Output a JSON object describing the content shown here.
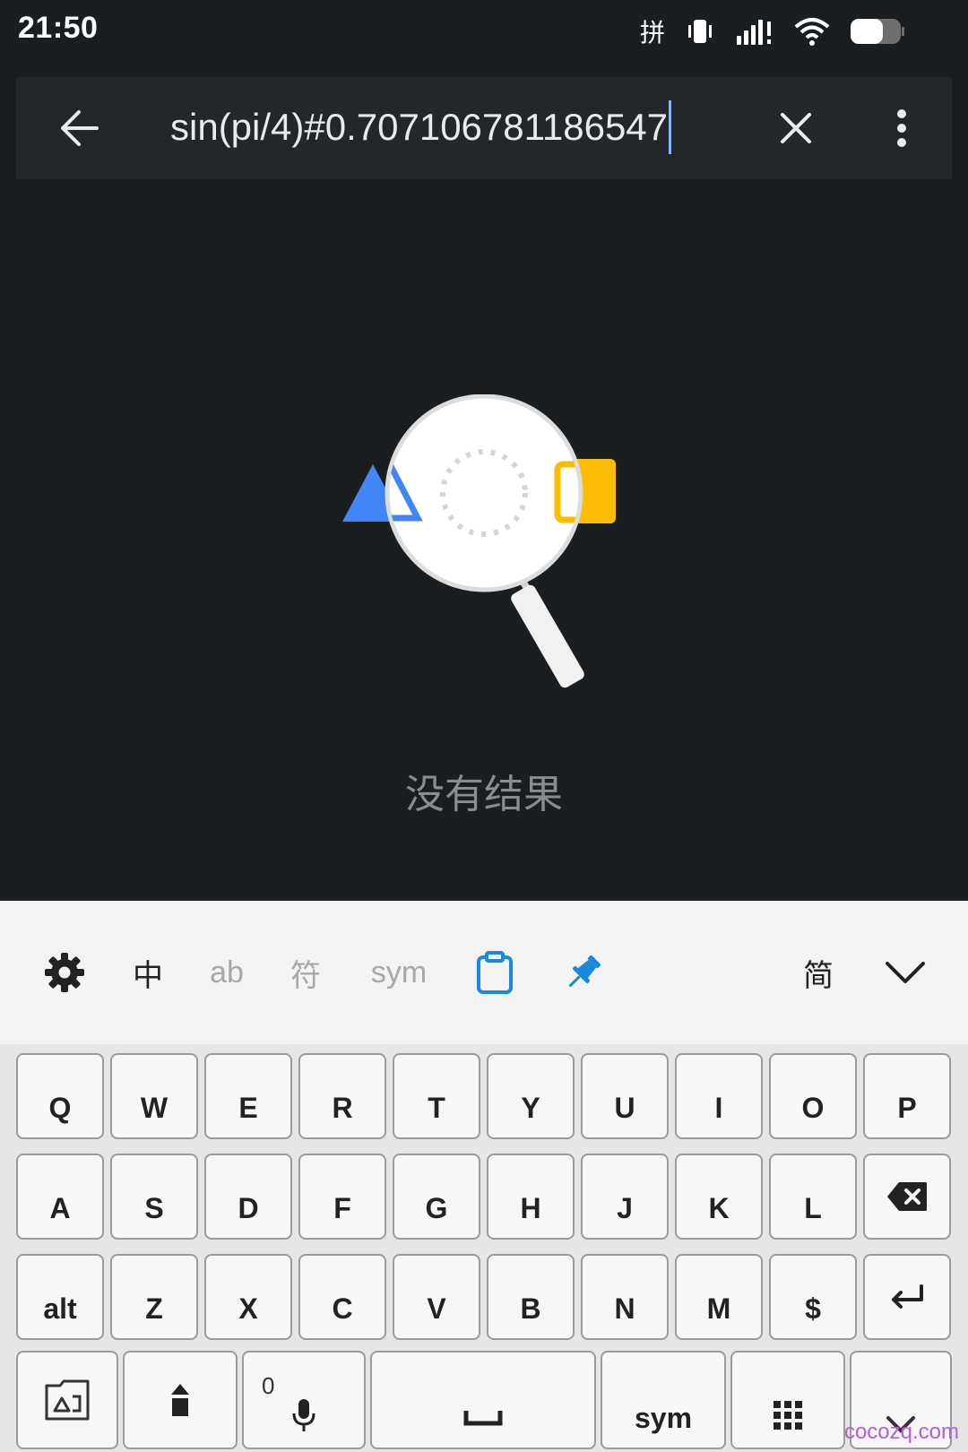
{
  "status_bar": {
    "time": "21:50",
    "ime_indicator": "拼",
    "icons": [
      "vibrate-icon",
      "signal-icon",
      "wifi-icon",
      "battery-icon"
    ]
  },
  "search": {
    "query": "sin(pi/4)#0.707106781186547",
    "icons": {
      "back": "arrow-left-icon",
      "clear": "close-icon",
      "more": "more-vert-icon"
    }
  },
  "empty_state": {
    "message": "没有结果",
    "colors": {
      "triangle": "#4285f4",
      "rectangle": "#fbbc04",
      "lens": "#ffffff"
    }
  },
  "keyboard_toolbar": {
    "items": [
      {
        "id": "settings",
        "icon": "gear-icon"
      },
      {
        "id": "chinese",
        "label": "中"
      },
      {
        "id": "english",
        "label": "ab"
      },
      {
        "id": "symbols_cn",
        "label": "符"
      },
      {
        "id": "symbols",
        "label": "sym"
      },
      {
        "id": "clipboard",
        "icon": "clipboard-icon"
      },
      {
        "id": "pin",
        "icon": "pin-icon"
      },
      {
        "id": "simplified",
        "label": "简"
      },
      {
        "id": "collapse",
        "icon": "chevron-down-icon"
      }
    ],
    "accent_color": "#1a8ad8"
  },
  "keyboard": {
    "row1": [
      "Q",
      "W",
      "E",
      "R",
      "T",
      "Y",
      "U",
      "I",
      "O",
      "P"
    ],
    "row2": [
      "A",
      "S",
      "D",
      "F",
      "G",
      "H",
      "J",
      "K",
      "L"
    ],
    "row3": [
      "alt",
      "Z",
      "X",
      "C",
      "V",
      "B",
      "N",
      "M",
      "$"
    ],
    "row4": {
      "mic_hint": "0",
      "sym_label": "sym",
      "icons": [
        "image-folder-icon",
        "shift-icon",
        "mic-icon",
        "space-icon",
        "grid-icon",
        "hide-keyboard-icon"
      ]
    },
    "icons": {
      "backspace": "backspace-icon",
      "enter": "enter-icon"
    }
  },
  "watermark": "cocozq.com"
}
